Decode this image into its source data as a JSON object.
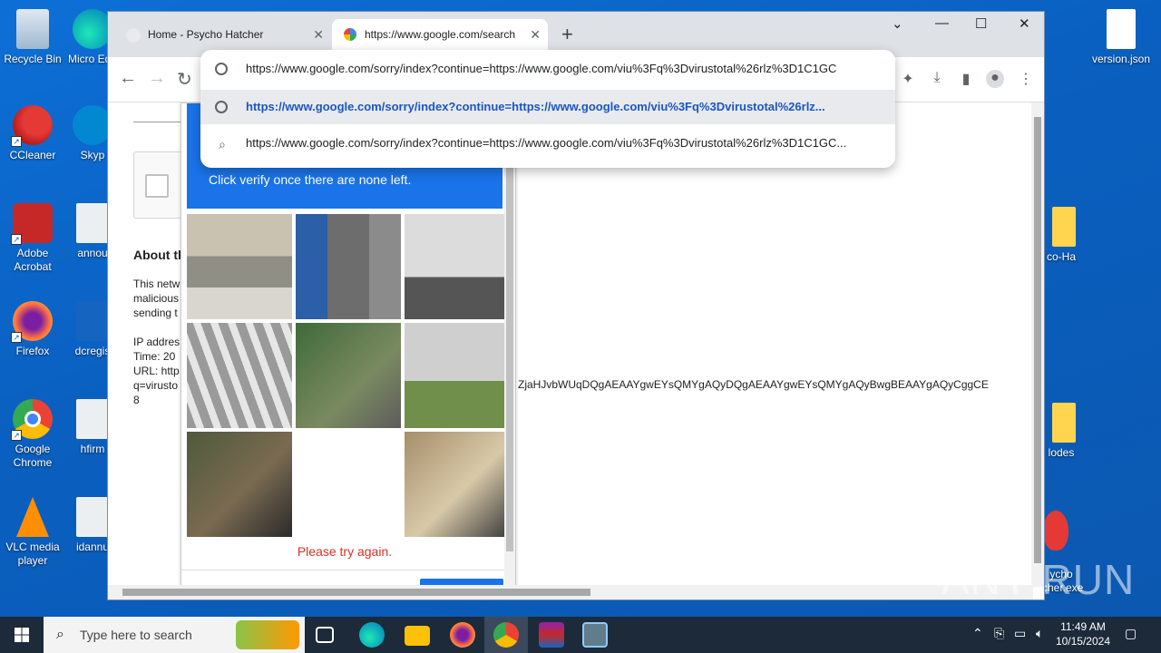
{
  "desktop": {
    "icons_left": [
      {
        "label": "Recycle Bin",
        "icon": "recycle-bin-icon"
      },
      {
        "label": "CCleaner",
        "icon": "ccleaner-icon"
      },
      {
        "label": "Adobe Acrobat",
        "icon": "acrobat-icon"
      },
      {
        "label": "Firefox",
        "icon": "firefox-icon"
      },
      {
        "label": "Google Chrome",
        "icon": "chrome-icon"
      },
      {
        "label": "VLC media player",
        "icon": "vlc-icon"
      }
    ],
    "icons_col2": [
      {
        "label": "Micro Edg",
        "icon": "edge-icon"
      },
      {
        "label": "Skyp",
        "icon": "skype-icon"
      },
      {
        "label": "annou",
        "icon": "image-file-icon"
      },
      {
        "label": "dcregis",
        "icon": "word-icon"
      },
      {
        "label": "hfirm",
        "icon": "image-file-icon"
      },
      {
        "label": "idannu",
        "icon": "image-file-icon"
      }
    ],
    "icons_right": [
      {
        "label": "version.json",
        "icon": "file-icon"
      },
      {
        "label": "co-Ha",
        "icon": "folder-icon"
      },
      {
        "label": "lodes",
        "icon": "folder-icon"
      },
      {
        "label": "ycho\ntcher.exe",
        "icon": "egg-icon"
      }
    ]
  },
  "browser": {
    "tabs": [
      {
        "title": "Home - Psycho Hatcher",
        "icon": "page-favicon"
      },
      {
        "title": "https://www.google.com/search",
        "icon": "google-favicon"
      }
    ],
    "address": "https://www.google.com/sorry/index?continue=https://www.google.com/viu%3Fq%3Dvirustotal%26rlz%3D1C1GC",
    "suggestions": [
      "https://www.google.com/sorry/index?continue=https://www.google.com/viu%3Fq%3Dvirustotal%26rlz...",
      "https://www.google.com/sorry/index?continue=https://www.google.com/viu%3Fq%3Dvirustotal%26rlz%3D1C1GC..."
    ]
  },
  "page": {
    "about_heading": "About th",
    "para1": [
      "This netw",
      "malicious",
      "sending t"
    ],
    "para2": [
      "IP addres",
      "Time: 20",
      "URL: http",
      "q=virusto",
      "8"
    ],
    "long_text": "ZjaHJvbWUqDQgAEAAYgwEYsQMYgAQyDQgAEAAYgwEYsQMYgAQyBwgBEAAYgAQyCggCE"
  },
  "captcha": {
    "instruction": "Click verify once there are none left.",
    "error": "Please try again.",
    "tiles": [
      "hill-wall",
      "bus-street",
      "building-corner",
      "crosswalk-path",
      "traffic-light",
      "motorhome",
      "motorcycle",
      "barrier-crosswalk",
      "balcony"
    ]
  },
  "taskbar": {
    "search_placeholder": "Type here to search",
    "time": "11:49 AM",
    "date": "10/15/2024"
  },
  "watermark": "ANY RUN"
}
